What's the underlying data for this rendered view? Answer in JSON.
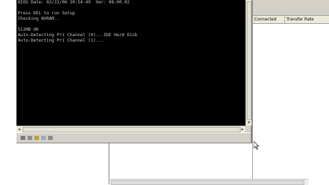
{
  "console": {
    "lines": [
      "BIOS Date: 02/22/06 20:54:49  Ver: 08.00.02",
      "",
      "Press DEL to run Setup",
      "Checking NVRAM..",
      "",
      "512MB OK",
      "Auto-Detecting Pri Channel (0)...IDE Hard Disk",
      "Auto-Detecting Pri Channel (1)..."
    ]
  },
  "host_panel": {
    "columns": [
      "Connected",
      "Transfer Rate"
    ]
  },
  "statusbar": {
    "icons": [
      "drive-icon",
      "folder-icon",
      "network-icon",
      "settings-icon"
    ]
  }
}
